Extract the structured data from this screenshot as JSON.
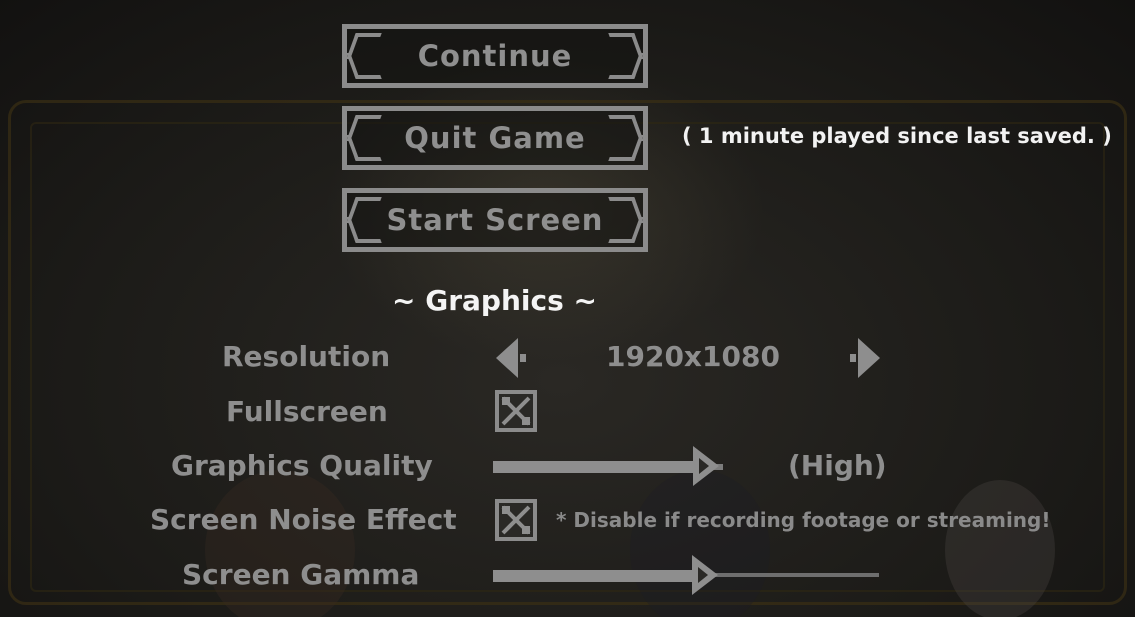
{
  "menu": {
    "continue_label": "Continue",
    "quit_label": "Quit Game",
    "start_screen_label": "Start Screen",
    "save_note": "( 1 minute played since last saved. )"
  },
  "graphics": {
    "section_title": "~ Graphics ~",
    "resolution": {
      "label": "Resolution",
      "value": "1920x1080"
    },
    "fullscreen": {
      "label": "Fullscreen",
      "checked": true
    },
    "quality": {
      "label": "Graphics Quality",
      "value_text": "(High)",
      "level": 0.6
    },
    "noise": {
      "label": "Screen Noise Effect",
      "checked": true,
      "hint": "* Disable if recording footage or streaming!"
    },
    "gamma": {
      "label": "Screen Gamma",
      "level": 0.55
    }
  },
  "colors": {
    "ui_gray": "#8e8e8e",
    "highlight_white": "#f4f4f4",
    "frame_gold": "#3a2f14",
    "background": "#1a1916"
  },
  "icons": {
    "arrow_left": "arrow-left-icon",
    "arrow_right": "arrow-right-icon",
    "checkbox_checked": "checkbox-x-icon",
    "slider_handle": "slider-thumb-icon"
  }
}
